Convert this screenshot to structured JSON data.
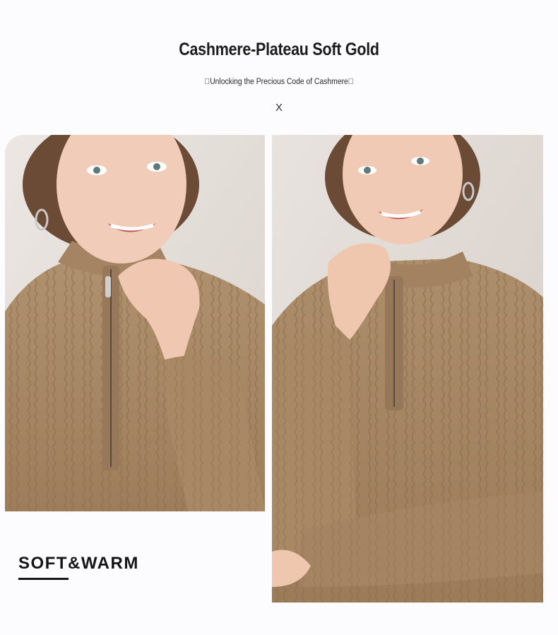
{
  "header": {
    "title": "Cashmere-Plateau Soft Gold",
    "subtitle": "\u0000Unlocking the Precious Code of Cashmere\u0000",
    "separator": "X"
  },
  "tagline": {
    "text": "SOFT&WARM"
  },
  "colors": {
    "background": "#fcfbfd",
    "sweater": "#a88864",
    "wall": "#e4dfdb",
    "skin": "#f0c9b3",
    "hair": "#6b4a36",
    "text": "#1c1c1c"
  }
}
